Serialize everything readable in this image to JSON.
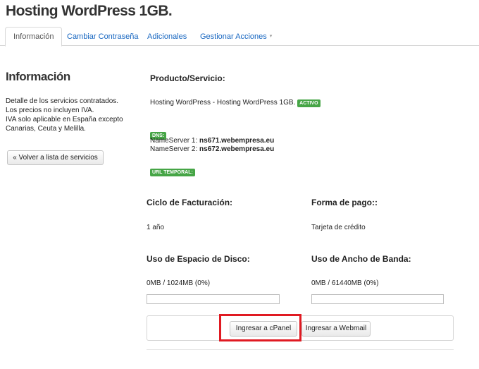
{
  "page": {
    "title": "Hosting WordPress 1GB."
  },
  "tabs": [
    {
      "label": "Información"
    },
    {
      "label": "Cambiar Contraseña"
    },
    {
      "label": "Adicionales"
    },
    {
      "label": "Gestionar Acciones",
      "caret": "▾"
    }
  ],
  "sidebar": {
    "heading": "Información",
    "desc": [
      "Detalle de los servicios contratados.",
      "Los precios no incluyen IVA.",
      "IVA solo aplicable en España excepto",
      "Canarias, Ceuta y Melilla."
    ],
    "back_button": "« Volver a lista de servicios"
  },
  "product": {
    "label": "Producto/Servicio:",
    "name": "Hosting WordPress - Hosting WordPress 1GB.",
    "status": "ACTIVO",
    "dns_badge": "DNS:",
    "ns1_label": "NameServer 1:",
    "ns1_value": "ns671.webempresa.eu",
    "ns2_label": "NameServer 2:",
    "ns2_value": "ns672.webempresa.eu",
    "temp_url_badge": "URL TEMPORAL:"
  },
  "billing": {
    "cycle_label": "Ciclo de Facturación:",
    "cycle_value": "1 año",
    "payment_label": "Forma de pago::",
    "payment_value": "Tarjeta de crédito"
  },
  "usage": {
    "disk_label": "Uso de Espacio de Disco:",
    "disk_value": "0MB / 1024MB (0%)",
    "disk_percent": 0,
    "bandwidth_label": "Uso de Ancho de Banda:",
    "bandwidth_value": "0MB / 61440MB (0%)",
    "bandwidth_percent": 0
  },
  "actions": {
    "cpanel": "Ingresar a cPanel",
    "webmail": "Ingresar a Webmail"
  },
  "colors": {
    "link": "#1565c0",
    "badge_green": "#46a546",
    "highlight_red": "#e01a22"
  }
}
